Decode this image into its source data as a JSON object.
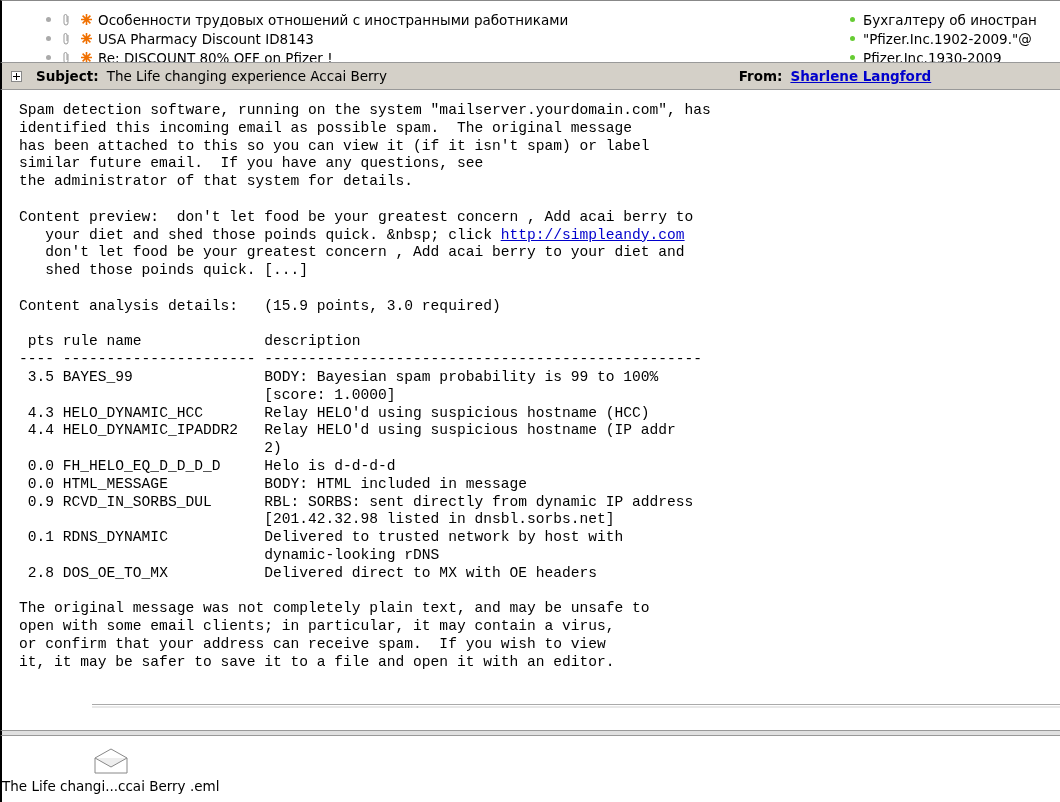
{
  "message_list": [
    {
      "subject": "Особенности трудовых отношений с иностранными работниками",
      "sender": "Бухгалтеру об иностран"
    },
    {
      "subject": "USA Pharmacy Discount ID8143",
      "sender": "\"Pfizer.Inc.1902-2009.\"@"
    },
    {
      "subject": "Re: DISCOUNT 80% OFF on Pfizer !",
      "sender": "Pfizer.Inc.1930-2009"
    }
  ],
  "header": {
    "expanded": false,
    "subject_label": "Subject:",
    "subject": "The Life changing experience Accai Berry",
    "from_label": "From:",
    "from": "Sharlene Langford"
  },
  "body": {
    "intro": "Spam detection software, running on the system \"mailserver.yourdomain.com\", has\nidentified this incoming email as possible spam.  The original message\nhas been attached to this so you can view it (if it isn't spam) or label\nsimilar future email.  If you have any questions, see\nthe administrator of that system for details.",
    "preview_before": "Content preview:  don't let food be your greatest concern , Add acai berry to\n   your diet and shed those poinds quick. &nbsp; click ",
    "preview_link": "http://simpleandy.com",
    "preview_after": "\n   don't let food be your greatest concern , Add acai berry to your diet and\n   shed those poinds quick. [...]",
    "analysis": "Content analysis details:   (15.9 points, 3.0 required)",
    "columns": [
      "pts",
      "rule name",
      "description"
    ],
    "separator": "---- ---------------------- --------------------------------------------------",
    "rules": [
      {
        "pts": "3.5",
        "rule": "BAYES_99",
        "description": "BODY: Bayesian spam probability is 99 to 100%\n[score: 1.0000]"
      },
      {
        "pts": "4.3",
        "rule": "HELO_DYNAMIC_HCC",
        "description": "Relay HELO'd using suspicious hostname (HCC)"
      },
      {
        "pts": "4.4",
        "rule": "HELO_DYNAMIC_IPADDR2",
        "description": "Relay HELO'd using suspicious hostname (IP addr\n2)"
      },
      {
        "pts": "0.0",
        "rule": "FH_HELO_EQ_D_D_D_D",
        "description": "Helo is d-d-d-d"
      },
      {
        "pts": "0.0",
        "rule": "HTML_MESSAGE",
        "description": "BODY: HTML included in message"
      },
      {
        "pts": "0.9",
        "rule": "RCVD_IN_SORBS_DUL",
        "description": "RBL: SORBS: sent directly from dynamic IP address\n[201.42.32.98 listed in dnsbl.sorbs.net]"
      },
      {
        "pts": "0.1",
        "rule": "RDNS_DYNAMIC",
        "description": "Delivered to trusted network by host with\ndynamic-looking rDNS"
      },
      {
        "pts": "2.8",
        "rule": "DOS_OE_TO_MX",
        "description": "Delivered direct to MX with OE headers"
      }
    ],
    "outro": "The original message was not completely plain text, and may be unsafe to\nopen with some email clients; in particular, it may contain a virus,\nor confirm that your address can receive spam.  If you wish to view\nit, it may be safer to save it to a file and open it with an editor."
  },
  "attachment": {
    "name": "The Life changi...ccai Berry .eml"
  }
}
